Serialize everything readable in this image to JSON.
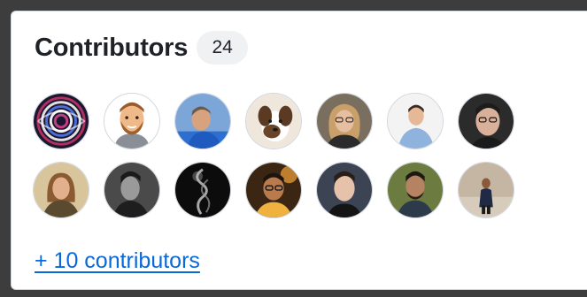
{
  "contributors": {
    "title": "Contributors",
    "count": "24",
    "more_link": "+ 10 contributors",
    "avatars": [
      {
        "name": "contributor-avatar-1",
        "icon": "spiral-pattern-avatar",
        "bg": "#2a2140"
      },
      {
        "name": "contributor-avatar-2",
        "icon": "cartoon-bearded-avatar",
        "bg": "#ffffff"
      },
      {
        "name": "contributor-avatar-3",
        "icon": "person-photo-avatar",
        "bg": "#5d8ac9"
      },
      {
        "name": "contributor-avatar-4",
        "icon": "dog-photo-avatar",
        "bg": "#e8ddd2"
      },
      {
        "name": "contributor-avatar-5",
        "icon": "person-photo-avatar",
        "bg": "#6b5f4e"
      },
      {
        "name": "contributor-avatar-6",
        "icon": "person-photo-avatar",
        "bg": "#f1f1f1"
      },
      {
        "name": "contributor-avatar-7",
        "icon": "person-photo-avatar",
        "bg": "#3a3a3a"
      },
      {
        "name": "contributor-avatar-8",
        "icon": "person-photo-avatar",
        "bg": "#d8c29a"
      },
      {
        "name": "contributor-avatar-9",
        "icon": "person-photo-avatar",
        "bg": "#2e2e2e"
      },
      {
        "name": "contributor-avatar-10",
        "icon": "smoke-photo-avatar",
        "bg": "#111111"
      },
      {
        "name": "contributor-avatar-11",
        "icon": "person-photo-avatar",
        "bg": "#c17a2a"
      },
      {
        "name": "contributor-avatar-12",
        "icon": "person-photo-avatar",
        "bg": "#3b4250"
      },
      {
        "name": "contributor-avatar-13",
        "icon": "person-photo-avatar",
        "bg": "#6a7a3f"
      },
      {
        "name": "contributor-avatar-14",
        "icon": "person-photo-avatar",
        "bg": "#d9cfc0"
      }
    ]
  }
}
